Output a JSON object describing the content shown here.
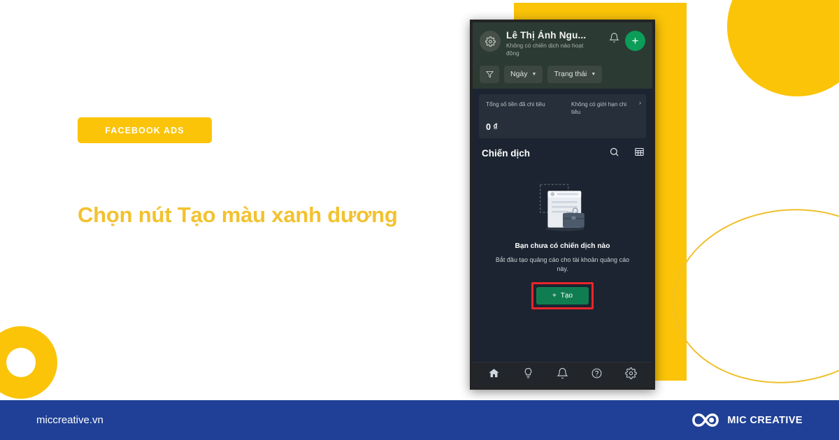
{
  "decor": {
    "yellow": "#FBC408",
    "ellipse_stroke": "#EFC02C",
    "circle_top_right": "circle-decoration",
    "donut_bottom_left": "donut-decoration"
  },
  "left": {
    "badge_label": "FACEBOOK ADS",
    "headline": "Chọn nút Tạo màu xanh dương"
  },
  "phone": {
    "header": {
      "account_name": "Lê Thị Ánh Ngu...",
      "account_status": "Không có chiến dịch nào hoạt động",
      "gear_icon": "gear-icon",
      "bell_icon": "bell-icon",
      "plus_label": "+"
    },
    "filters": {
      "filter_icon": "funnel-icon",
      "date_label": "Ngày",
      "status_label": "Trạng thái",
      "caret": "▼"
    },
    "spend": {
      "total_label": "Tổng số tiền đã chi tiêu",
      "limit_label": "Không có giới hạn chi tiêu",
      "amount": "0 ₫",
      "chevron": "›"
    },
    "campaigns": {
      "title": "Chiến dịch",
      "search_icon": "search-icon",
      "table_icon": "table-view-icon"
    },
    "empty_state": {
      "illustration": "empty-campaign-illustration",
      "heading": "Bạn chưa có chiến dịch nào",
      "body": "Bắt đầu tạo quảng cáo cho tài khoản quảng cáo này.",
      "create_label": "Tạo",
      "create_plus": "+",
      "highlight_color": "#e8262b",
      "button_color": "#107d50"
    },
    "bottom_nav": [
      {
        "icon": "home-icon",
        "name": "nav-home"
      },
      {
        "icon": "lightbulb-icon",
        "name": "nav-ideas"
      },
      {
        "icon": "bell-icon",
        "name": "nav-notifications"
      },
      {
        "icon": "help-icon",
        "name": "nav-help"
      },
      {
        "icon": "gear-icon",
        "name": "nav-settings"
      }
    ]
  },
  "footer": {
    "url": "miccreative.vn",
    "brand_name": "MIC CREATIVE",
    "logo_icon": "infinity-logo-icon",
    "background": "#1F4096"
  }
}
